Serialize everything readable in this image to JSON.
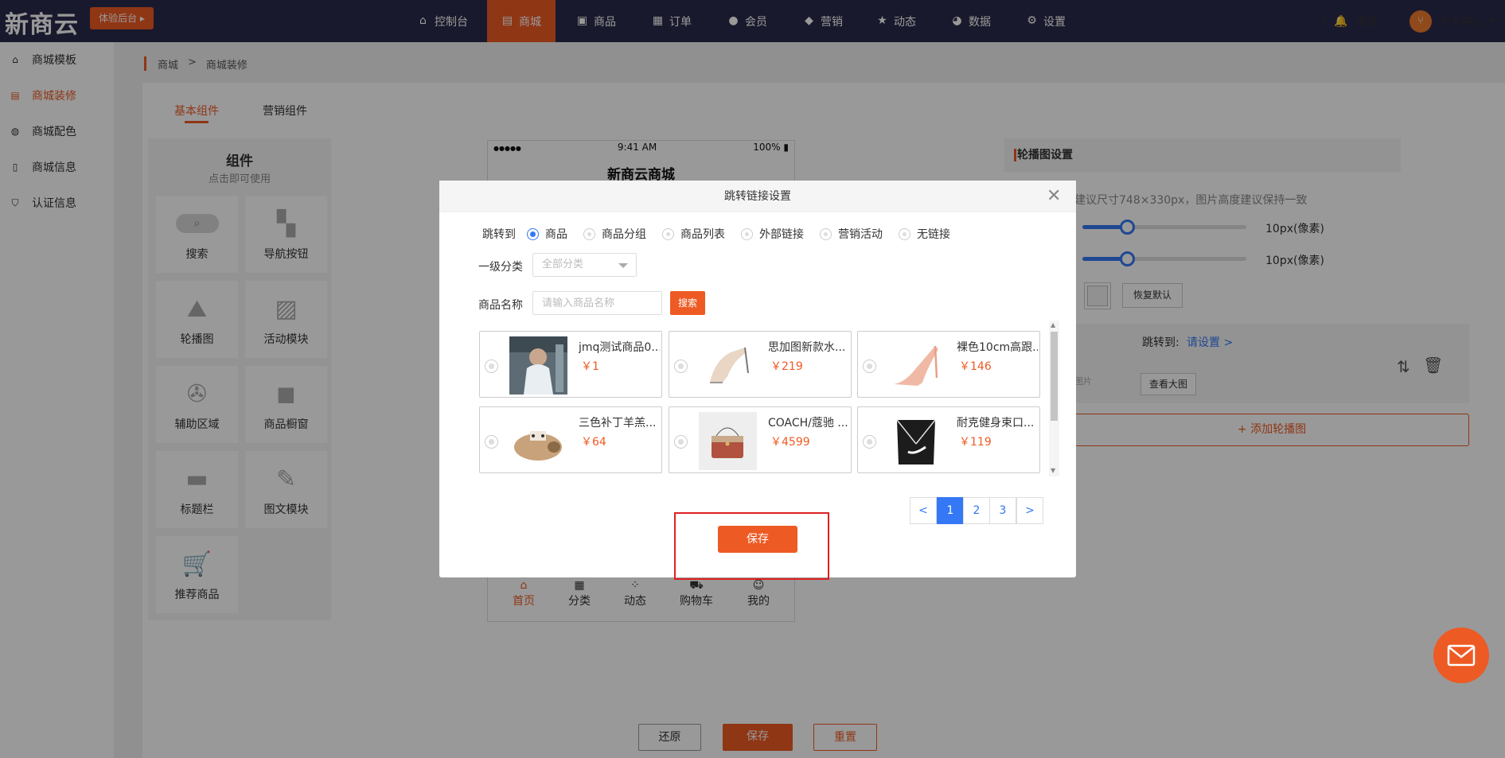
{
  "app": {
    "logo": "新商云",
    "trial_label": "体验后台"
  },
  "topnav": [
    {
      "label": "控制台",
      "icon": "home-icon"
    },
    {
      "label": "商城",
      "icon": "store-icon"
    },
    {
      "label": "商品",
      "icon": "goods-icon"
    },
    {
      "label": "订单",
      "icon": "order-icon"
    },
    {
      "label": "会员",
      "icon": "member-icon"
    },
    {
      "label": "营销",
      "icon": "cube-icon"
    },
    {
      "label": "动态",
      "icon": "star-icon"
    },
    {
      "label": "数据",
      "icon": "pie-icon"
    },
    {
      "label": "设置",
      "icon": "gear-icon"
    }
  ],
  "header_right": {
    "message": "消息",
    "user": "个人中心"
  },
  "sidebar": [
    {
      "label": "商城模板"
    },
    {
      "label": "商城装修"
    },
    {
      "label": "商城配色"
    },
    {
      "label": "商城信息"
    },
    {
      "label": "认证信息"
    }
  ],
  "breadcrumb": {
    "root": "商城",
    "sep": ">",
    "current": "商城装修"
  },
  "tabs": {
    "basic": "基本组件",
    "marketing": "营销组件"
  },
  "components": {
    "title": "组件",
    "subtitle": "点击即可使用",
    "items": [
      "搜索",
      "导航按钮",
      "轮播图",
      "活动模块",
      "辅助区域",
      "商品橱窗",
      "标题栏",
      "图文模块",
      "推荐商品"
    ]
  },
  "phone": {
    "time": "9:41 AM",
    "battery": "100%",
    "signal": "●●●●●",
    "title": "新商云商城",
    "nav": [
      "首页",
      "分类",
      "动态",
      "购物车",
      "我的"
    ]
  },
  "right_panel": {
    "title": "轮播图设置",
    "hint": "建议尺寸748×330px，图片高度建议保持一致",
    "slider1_value": "10px(像素)",
    "slider2_value": "10px(像素)",
    "slider1_level": 0.27,
    "slider2_level": 0.27,
    "reset_default": "恢复默认",
    "jump_to": "跳转到:",
    "jump_link": "请设置 >",
    "view_large": "查看大图",
    "image_label": "图片",
    "add_banner": "+ 添加轮播图"
  },
  "bottom_buttons": {
    "restore": "还原",
    "save": "保存",
    "reset": "重置"
  },
  "modal": {
    "title": "跳转链接设置",
    "jump_label": "跳转到",
    "options": [
      "商品",
      "商品分组",
      "商品列表",
      "外部链接",
      "营销活动",
      "无链接"
    ],
    "selected_option": "商品",
    "category_label": "一级分类",
    "category_value": "全部分类",
    "name_label": "商品名称",
    "name_placeholder": "请输入商品名称",
    "search_button": "搜索",
    "products": [
      {
        "name": "jmq测试商品0...",
        "price": "￥1"
      },
      {
        "name": "思加图新款水...",
        "price": "￥219"
      },
      {
        "name": "裸色10cm高跟...",
        "price": "￥146"
      },
      {
        "name": "三色补丁羊羔...",
        "price": "￥64"
      },
      {
        "name": "COACH/蔻驰 ...",
        "price": "￥4599"
      },
      {
        "name": "耐克健身束口...",
        "price": "￥119"
      }
    ],
    "pagination": {
      "prev": "<",
      "pages": [
        "1",
        "2",
        "3"
      ],
      "current": "1",
      "next": ">"
    },
    "save_button": "保存"
  },
  "colors": {
    "brand": "#ee5a24",
    "topbar": "#2b2b4b",
    "link": "#3478f6",
    "highlight": "#e02020"
  }
}
